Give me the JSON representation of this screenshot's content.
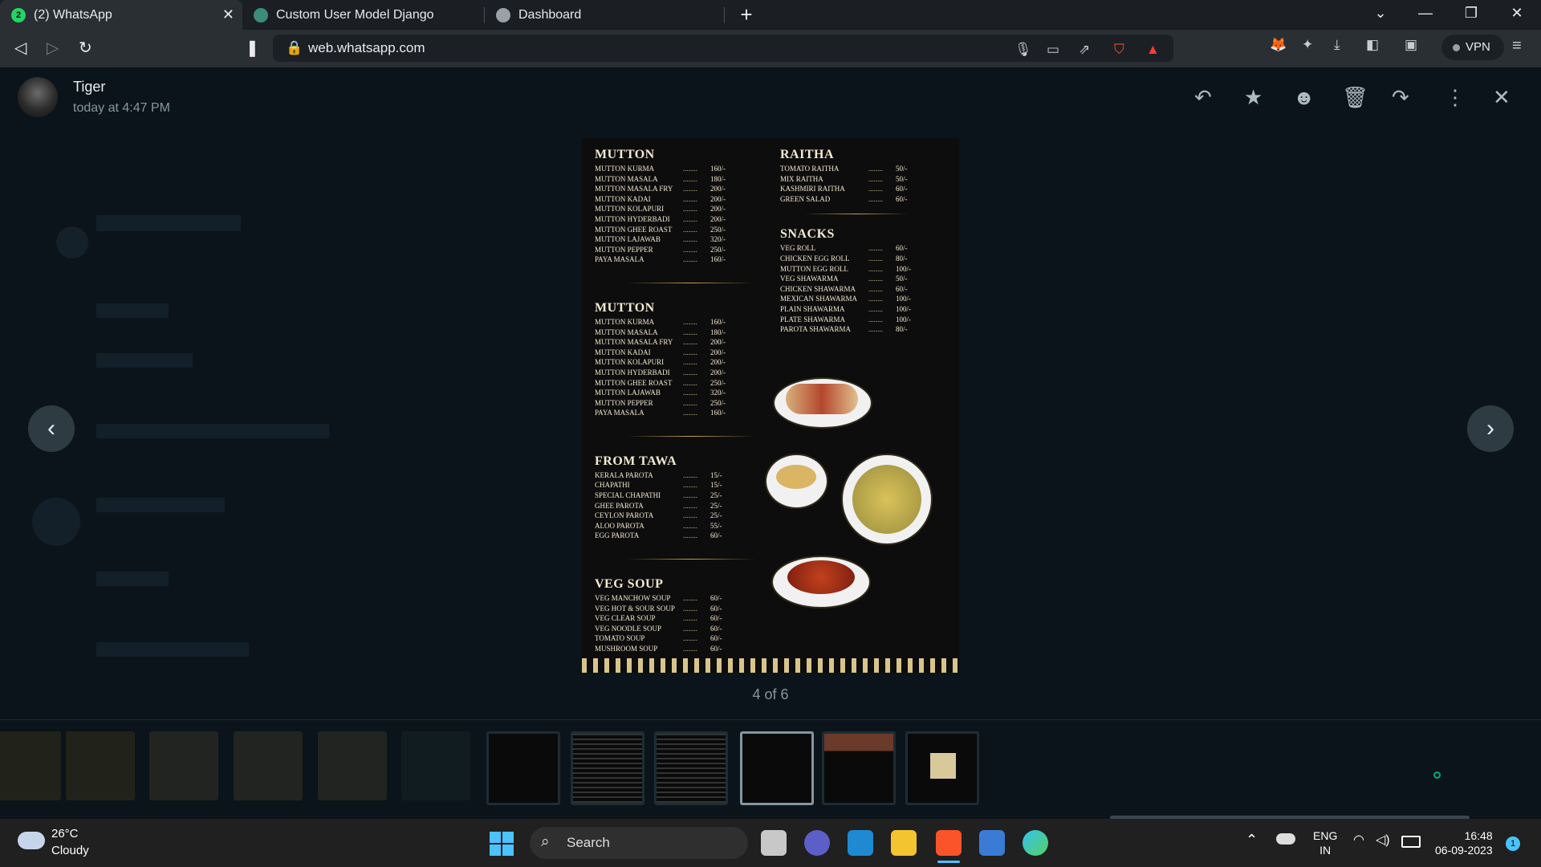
{
  "tabs": [
    {
      "label": "(2) WhatsApp",
      "active": true
    },
    {
      "label": "Custom User Model Django",
      "active": false
    },
    {
      "label": "Dashboard",
      "active": false
    }
  ],
  "window": {
    "new_tab": "+",
    "minimize": "—",
    "restore": "❐",
    "close": "✕",
    "dropdown": "⌄"
  },
  "toolbar": {
    "url": "web.whatsapp.com",
    "vpn_label": "VPN"
  },
  "viewer": {
    "sender": "Tiger",
    "time": "today at 4:47 PM",
    "counter": "4 of 6"
  },
  "menu": {
    "mutton1": {
      "title": "MUTTON",
      "items": [
        {
          "n": "MUTTON KURMA",
          "p": "160/-"
        },
        {
          "n": "MUTTON MASALA",
          "p": "180/-"
        },
        {
          "n": "MUTTON MASALA FRY",
          "p": "200/-"
        },
        {
          "n": "MUTTON KADAI",
          "p": "200/-"
        },
        {
          "n": "MUTTON KOLAPURI",
          "p": "200/-"
        },
        {
          "n": "MUTTON HYDERBADI",
          "p": "200/-"
        },
        {
          "n": "MUTTON GHEE ROAST",
          "p": "250/-"
        },
        {
          "n": "MUTTON LAJAWAB",
          "p": "320/-"
        },
        {
          "n": "MUTTON PEPPER",
          "p": "250/-"
        },
        {
          "n": "PAYA MASALA",
          "p": "160/-"
        }
      ]
    },
    "mutton2": {
      "title": "MUTTON",
      "items": [
        {
          "n": "MUTTON KURMA",
          "p": "160/-"
        },
        {
          "n": "MUTTON MASALA",
          "p": "180/-"
        },
        {
          "n": "MUTTON MASALA FRY",
          "p": "200/-"
        },
        {
          "n": "MUTTON KADAI",
          "p": "200/-"
        },
        {
          "n": "MUTTON KOLAPURI",
          "p": "200/-"
        },
        {
          "n": "MUTTON HYDERBADI",
          "p": "200/-"
        },
        {
          "n": "MUTTON GHEE ROAST",
          "p": "250/-"
        },
        {
          "n": "MUTTON LAJAWAB",
          "p": "320/-"
        },
        {
          "n": "MUTTON PEPPER",
          "p": "250/-"
        },
        {
          "n": "PAYA MASALA",
          "p": "160/-"
        }
      ]
    },
    "tawa": {
      "title": "FROM TAWA",
      "items": [
        {
          "n": "KERALA PAROTA",
          "p": "15/-"
        },
        {
          "n": "CHAPATHI",
          "p": "15/-"
        },
        {
          "n": "SPECIAL CHAPATHI",
          "p": "25/-"
        },
        {
          "n": "GHEE PAROTA",
          "p": "25/-"
        },
        {
          "n": "CEYLON PAROTA",
          "p": "25/-"
        },
        {
          "n": "ALOO PAROTA",
          "p": "55/-"
        },
        {
          "n": "EGG PAROTA",
          "p": "60/-"
        }
      ]
    },
    "soup": {
      "title": "VEG SOUP",
      "items": [
        {
          "n": "VEG MANCHOW SOUP",
          "p": "60/-"
        },
        {
          "n": "VEG HOT & SOUR SOUP",
          "p": "60/-"
        },
        {
          "n": "VEG CLEAR SOUP",
          "p": "60/-"
        },
        {
          "n": "VEG NOODLE SOUP",
          "p": "60/-"
        },
        {
          "n": "TOMATO SOUP",
          "p": "60/-"
        },
        {
          "n": "MUSHROOM SOUP",
          "p": "60/-"
        }
      ]
    },
    "raitha": {
      "title": "RAITHA",
      "items": [
        {
          "n": "TOMATO RAITHA",
          "p": "50/-"
        },
        {
          "n": "MIX RAITHA",
          "p": "50/-"
        },
        {
          "n": "KASHMIRI RAITHA",
          "p": "60/-"
        },
        {
          "n": "GREEN SALAD",
          "p": "60/-"
        }
      ]
    },
    "snacks": {
      "title": "SNACKS",
      "items": [
        {
          "n": "VEG ROLL",
          "p": "60/-"
        },
        {
          "n": "CHICKEN EGG ROLL",
          "p": "80/-"
        },
        {
          "n": "MUTTON EGG ROLL",
          "p": "100/-"
        },
        {
          "n": "VEG SHAWARMA",
          "p": "50/-"
        },
        {
          "n": "CHICKEN SHAWARMA",
          "p": "60/-"
        },
        {
          "n": "MEXICAN SHAWARMA",
          "p": "100/-"
        },
        {
          "n": "PLAIN SHAWARMA",
          "p": "100/-"
        },
        {
          "n": "PLATE SHAWARMA",
          "p": "100/-"
        },
        {
          "n": "PAROTA SHAWARMA",
          "p": "80/-"
        }
      ]
    }
  },
  "taskbar": {
    "temp": "26°C",
    "condition": "Cloudy",
    "search": "Search",
    "lang1": "ENG",
    "lang2": "IN",
    "time": "16:48",
    "date": "06-09-2023",
    "notif": "1"
  }
}
